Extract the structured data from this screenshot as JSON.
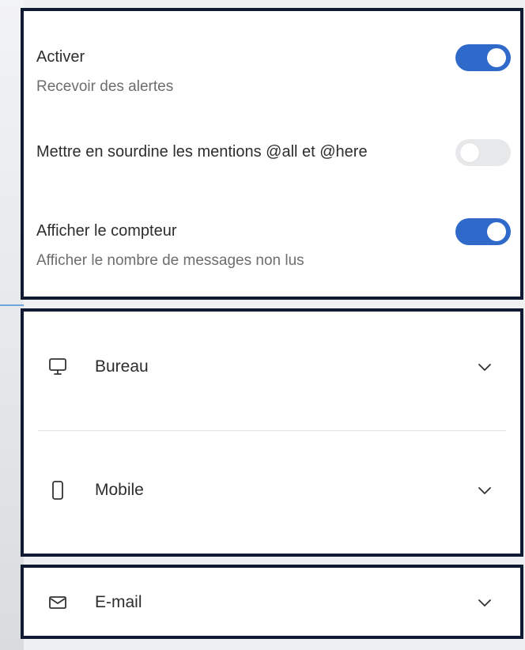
{
  "notifications": {
    "settings": [
      {
        "title": "Activer",
        "description": "Recevoir des alertes",
        "enabled": true
      },
      {
        "title": "Mettre en sourdine les mentions @all et @here",
        "description": "",
        "enabled": false
      },
      {
        "title": "Afficher le compteur",
        "description": "Afficher le nombre de messages non lus",
        "enabled": true
      }
    ]
  },
  "sections": {
    "bureau": {
      "label": "Bureau",
      "icon": "monitor-icon",
      "expanded": false
    },
    "mobile": {
      "label": "Mobile",
      "icon": "smartphone-icon",
      "expanded": false
    },
    "email": {
      "label": "E-mail",
      "icon": "envelope-icon",
      "expanded": false
    }
  },
  "colors": {
    "toggle_on": "#2f69c9",
    "toggle_off": "#e7e8ea",
    "frame": "#101a33"
  }
}
